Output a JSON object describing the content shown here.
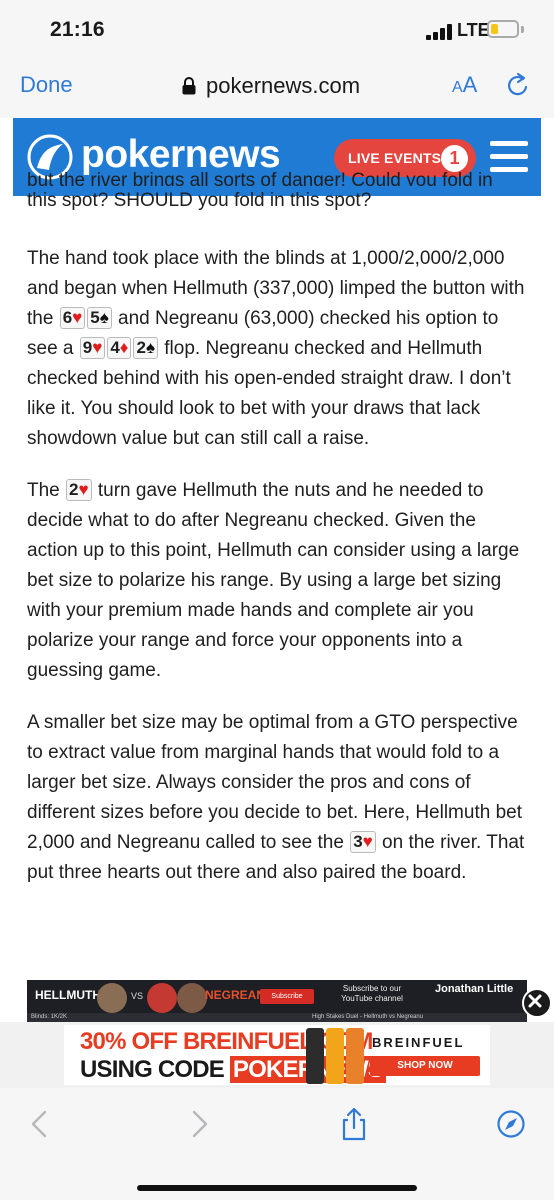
{
  "status_bar": {
    "time": "21:16",
    "network": "LTE"
  },
  "browser": {
    "done_label": "Done",
    "url": "pokernews.com",
    "text_size_label_large": "A",
    "text_size_label_small": "A"
  },
  "site": {
    "logo_text": "pokernews",
    "live_events_label": "LIVE EVENTS",
    "live_events_count": "1"
  },
  "article": {
    "cut_line": "but the river brings all sorts of danger! Could you fold in",
    "p0": "this spot? SHOULD you fold in this spot?",
    "p1": {
      "a": "The hand took place with the blinds at 1,000/2,000/2,000 and began when Hellmuth (337,000) limped the button with the ",
      "card1_rank": "6",
      "card1_suit": "♥",
      "card2_rank": "5",
      "card2_suit": "♠",
      "b": " and Negreanu (63,000) checked his option to see a ",
      "flop1_rank": "9",
      "flop1_suit": "♥",
      "flop2_rank": "4",
      "flop2_suit": "♦",
      "flop3_rank": "2",
      "flop3_suit": "♠",
      "c": " flop. Negreanu checked and Hellmuth checked behind with his open-ended straight draw. I don’t like it. You should look to bet with your draws that lack showdown value but can still call a raise."
    },
    "p2": {
      "a": "The ",
      "turn_rank": "2",
      "turn_suit": "♥",
      "b": " turn gave Hellmuth the nuts and he needed to decide what to do after Negreanu checked. Given the action up to this point, Hellmuth can consider using a large bet size to polarize his range. By using a large bet sizing with your premium made hands and complete air you polarize your range and force your opponents into a guessing game."
    },
    "p3": {
      "a": "A smaller bet size may be optimal from a GTO perspective to extract value from marginal hands that would fold to a larger bet size. Always consider the pros and cons of different sizes before you decide to bet. Here, Hellmuth bet 2,000 and Negreanu called to see the ",
      "river_rank": "3",
      "river_suit": "♥",
      "b": " on the river. That put three hearts out there and also paired the board."
    }
  },
  "video": {
    "left_name": "HELLMUTH",
    "vs": "VS",
    "right_name": "NEGREANU",
    "subscribe": "Subscribe",
    "subscribe_text": "Subscribe to our YouTube channel",
    "channel": "Jonathan Little",
    "blinds": "Blinds: 1K/2K",
    "duel_title": "High Stakes Duel - Hellmuth vs Negreanu"
  },
  "ad": {
    "line1": "30% OFF BREINFUEL.COM",
    "line2_prefix": "USING CODE ",
    "line2_code": "POKERNEWS",
    "brand": "BREINFUEL",
    "cta": "SHOP NOW"
  },
  "colors": {
    "accent_blue": "#1f7bd4",
    "live_red": "#e4453f",
    "ios_blue": "#2f7ad8",
    "ad_red": "#e73b22"
  },
  "icons": [
    "lock-icon",
    "reload-icon",
    "pokernews-logo-icon",
    "menu-icon",
    "close-ad-icon",
    "back-icon",
    "forward-icon",
    "share-icon",
    "compass-icon"
  ]
}
